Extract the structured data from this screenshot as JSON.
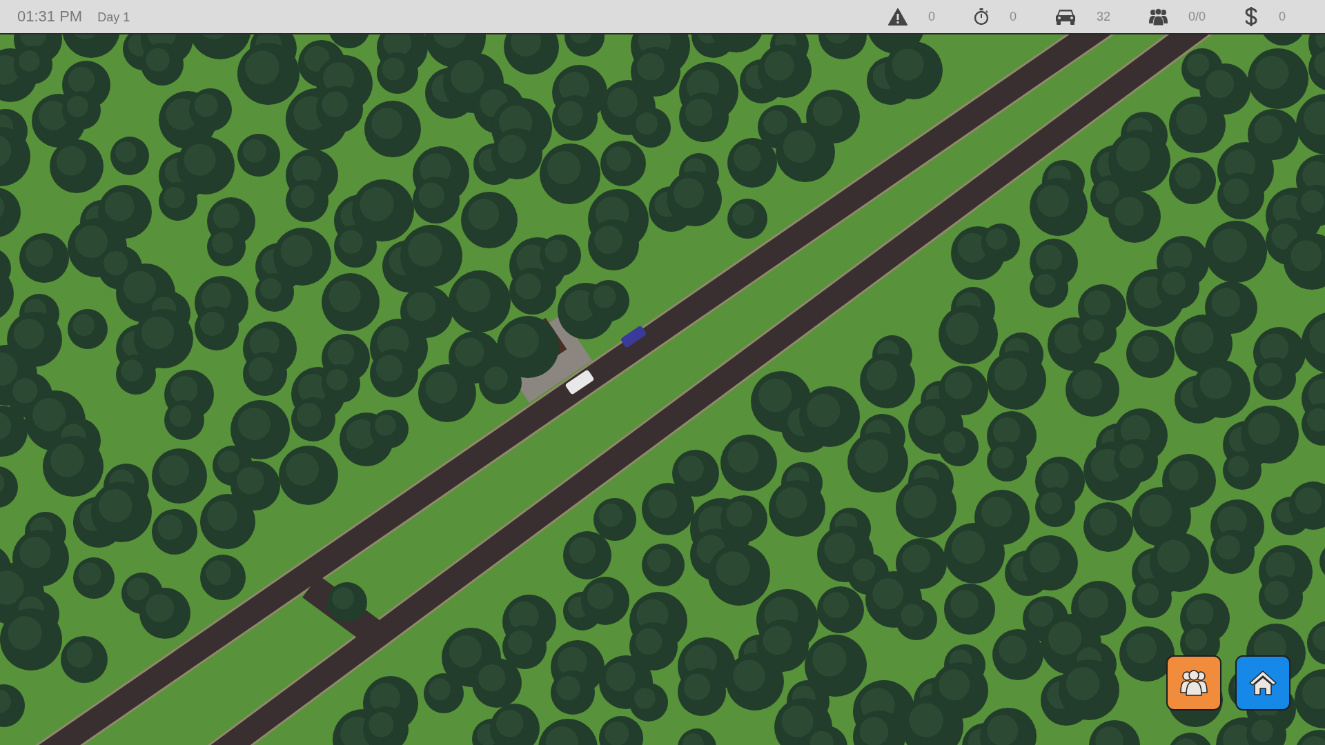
{
  "clock": {
    "time": "01:31 PM",
    "day": "Day 1"
  },
  "stats": [
    {
      "kind": "warning",
      "value": "0"
    },
    {
      "kind": "stopwatch",
      "value": "0"
    },
    {
      "kind": "car",
      "value": "32"
    },
    {
      "kind": "people",
      "value": "0/0"
    },
    {
      "kind": "money",
      "value": "0"
    }
  ],
  "buttons": [
    {
      "kind": "staff",
      "color": "#f08c3c"
    },
    {
      "kind": "home",
      "color": "#1688e8"
    }
  ]
}
